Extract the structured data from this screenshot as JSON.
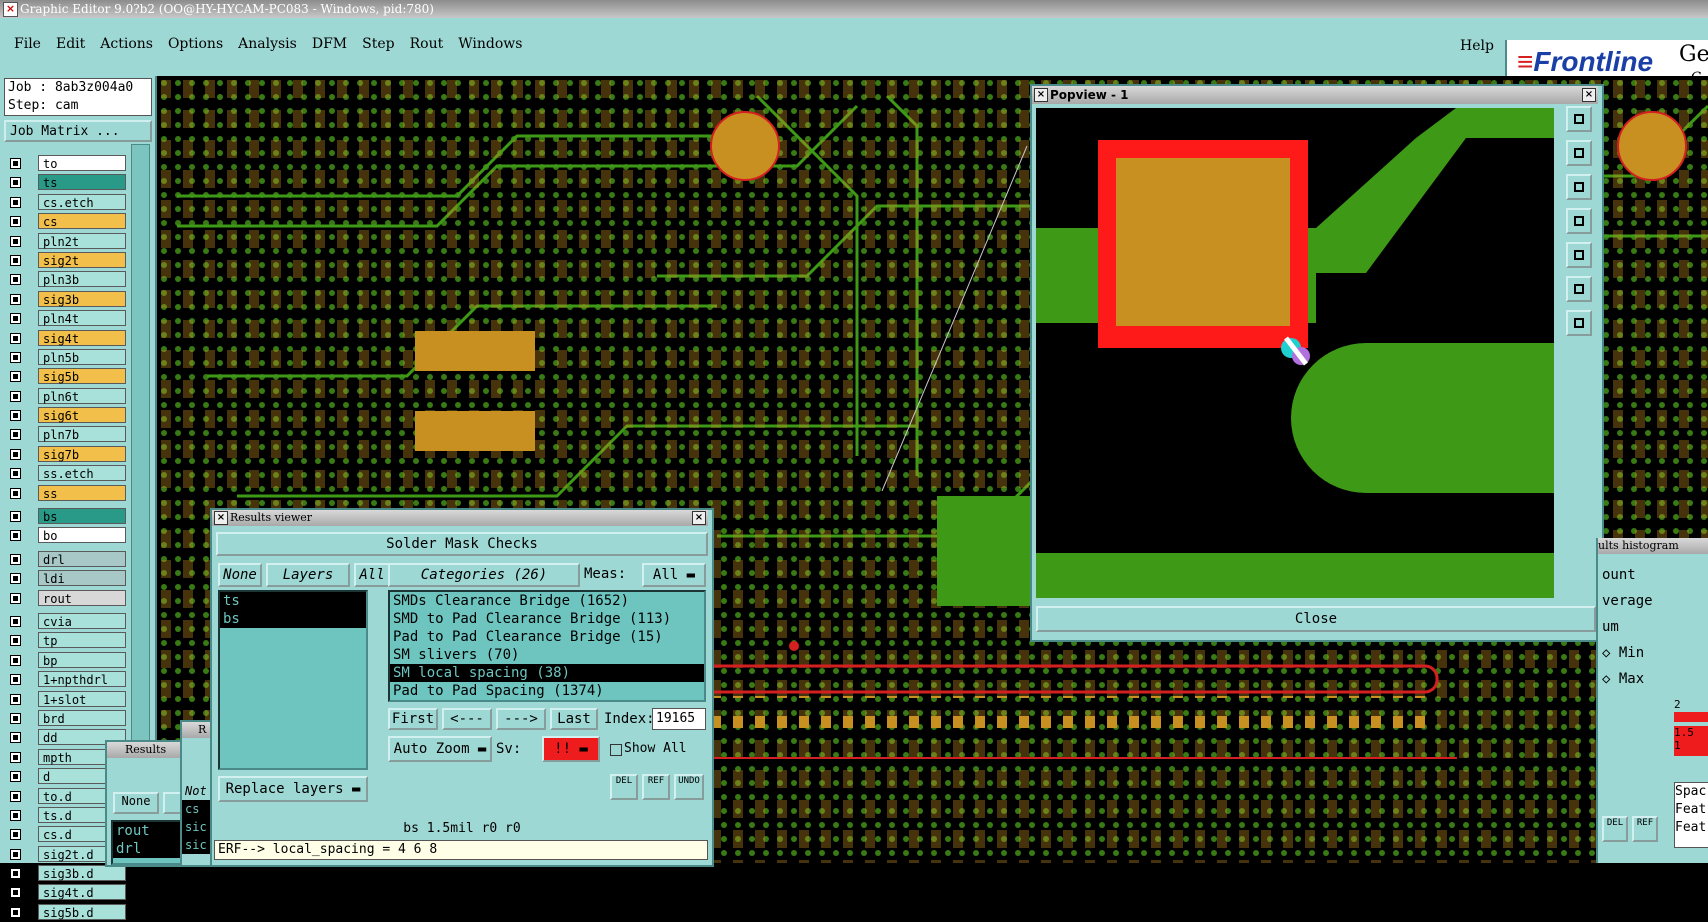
{
  "window_title": "Graphic Editor 9.0?b2 (OO@HY-HYCAM-PC083 - Windows, pid:780)",
  "menu": {
    "items": [
      "File",
      "Edit",
      "Actions",
      "Options",
      "Analysis",
      "DFM",
      "Step",
      "Rout",
      "Windows"
    ],
    "help": "Help"
  },
  "brand": {
    "logo": "Frontline",
    "ge": "Ge",
    "g2": "G"
  },
  "job": {
    "job_line": "Job : 8ab3z004a0",
    "step_line": "Step: cam",
    "matrix_button": "Job Matrix ..."
  },
  "layers": [
    {
      "name": "to",
      "color": "#ffffff"
    },
    {
      "name": "ts",
      "color": "#2a9a88"
    },
    {
      "name": "cs.etch",
      "color": "#a8e0da"
    },
    {
      "name": "cs",
      "color": "#f2c04a"
    },
    {
      "name": "pln2t",
      "color": "#a8e0da"
    },
    {
      "name": "sig2t",
      "color": "#f2c04a"
    },
    {
      "name": "pln3b",
      "color": "#a8e0da"
    },
    {
      "name": "sig3b",
      "color": "#f2c04a"
    },
    {
      "name": "pln4t",
      "color": "#a8e0da"
    },
    {
      "name": "sig4t",
      "color": "#f2c04a"
    },
    {
      "name": "pln5b",
      "color": "#a8e0da"
    },
    {
      "name": "sig5b",
      "color": "#f2c04a"
    },
    {
      "name": "pln6t",
      "color": "#a8e0da"
    },
    {
      "name": "sig6t",
      "color": "#f2c04a"
    },
    {
      "name": "pln7b",
      "color": "#a8e0da"
    },
    {
      "name": "sig7b",
      "color": "#f2c04a"
    },
    {
      "name": "ss.etch",
      "color": "#a8e0da"
    },
    {
      "name": "ss",
      "color": "#f2c04a"
    },
    {
      "name": "bs",
      "color": "#2a9a88"
    },
    {
      "name": "bo",
      "color": "#ffffff"
    },
    {
      "name": "drl",
      "color": "#a8c8c8"
    },
    {
      "name": "ldi",
      "color": "#a8c8c8"
    },
    {
      "name": "rout",
      "color": "#d8d8d8"
    },
    {
      "name": "cvia",
      "color": "#a8e0da"
    },
    {
      "name": "tp",
      "color": "#a8e0da"
    },
    {
      "name": "bp",
      "color": "#a8e0da"
    },
    {
      "name": "1+npthdrl",
      "color": "#a8e0da"
    },
    {
      "name": "1+slot",
      "color": "#a8e0da"
    },
    {
      "name": "brd",
      "color": "#a8e0da"
    },
    {
      "name": "dd",
      "color": "#a8e0da"
    },
    {
      "name": "mpth",
      "color": "#a8e0da"
    },
    {
      "name": "d",
      "color": "#a8e0da"
    },
    {
      "name": "to.d",
      "color": "#a8e0da"
    },
    {
      "name": "ts.d",
      "color": "#a8e0da"
    },
    {
      "name": "cs.d",
      "color": "#a8e0da"
    },
    {
      "name": "sig2t.d",
      "color": "#a8e0da"
    },
    {
      "name": "sig3b.d",
      "color": "#a8e0da"
    },
    {
      "name": "sig4t.d",
      "color": "#a8e0da"
    },
    {
      "name": "sig5b.d",
      "color": "#a8e0da"
    }
  ],
  "popview": {
    "title": "Popview - 1",
    "close": "Close"
  },
  "results": {
    "title": "Results viewer",
    "header": "Solder Mask Checks",
    "none": "None",
    "layers": "Layers",
    "all": "All",
    "layer_list": [
      "ts",
      "bs"
    ],
    "categories": "Categories (26)",
    "meas_label": "Meas:",
    "meas_value": "All",
    "items": [
      "SMDs Clearance Bridge (1652)",
      "SMD to Pad Clearance Bridge (113)",
      "Pad to Pad Clearance Bridge (15)",
      "SM slivers (70)",
      "SM local spacing (38)",
      "Pad to Pad Spacing (1374)"
    ],
    "selected_index": 4,
    "first": "First",
    "prev": "<---",
    "next": "--->",
    "last": "Last",
    "index_label": "Index:",
    "index_value": "19165",
    "zoom": "Auto Zoom",
    "sv_label": "Sv:",
    "sv_value": "!!",
    "show_all": "Show All",
    "replace": "Replace layers",
    "del": "DEL",
    "ref": "REF",
    "undo": "UNDO",
    "status": "bs 1.5mil  r0  r0",
    "erf": "ERF--> local_spacing = 4 6 8"
  },
  "histogram": {
    "title": "ults histogram",
    "items": [
      "ount",
      "verage",
      "um"
    ],
    "min": "Min",
    "max": "Max",
    "fields": [
      "Spac",
      "Feat",
      "Feat"
    ],
    "del": "DEL",
    "ref": "REF",
    "val1": "2",
    "val2": "1.5",
    "val3": "1"
  },
  "stacked": {
    "title1": "Results",
    "none": "None",
    "l": "L",
    "list": [
      "rout",
      "drl"
    ],
    "title2": "R",
    "no": "Not",
    "list2": [
      "cs",
      "sic",
      "sic"
    ]
  }
}
